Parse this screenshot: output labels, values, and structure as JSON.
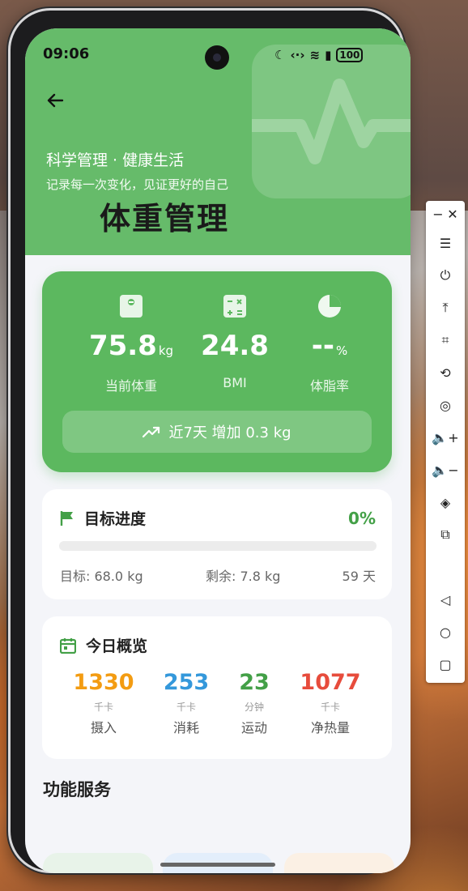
{
  "status_bar": {
    "time": "09:06",
    "battery": "100"
  },
  "header": {
    "subtitle": "科学管理 · 健康生活",
    "slogan": "记录每一次变化，见证更好的自己",
    "title": "体重管理"
  },
  "stats": {
    "weight": {
      "value": "75.8",
      "unit": "kg",
      "label": "当前体重"
    },
    "bmi": {
      "value": "24.8",
      "label": "BMI"
    },
    "body_fat": {
      "value": "--",
      "unit": "%",
      "label": "体脂率"
    },
    "trend": "近7天 增加 0.3 kg"
  },
  "goal": {
    "title": "目标进度",
    "percent": "0%",
    "progress_fraction": 0,
    "target": "目标: 68.0 kg",
    "remaining": "剩余: 7.8 kg",
    "days": "59 天"
  },
  "today": {
    "title": "今日概览",
    "items": [
      {
        "value": "1330",
        "unit": "千卡",
        "label": "摄入",
        "color": "#f39c12"
      },
      {
        "value": "253",
        "unit": "千卡",
        "label": "消耗",
        "color": "#3498db"
      },
      {
        "value": "23",
        "unit": "分钟",
        "label": "运动",
        "color": "#43a047"
      },
      {
        "value": "1077",
        "unit": "千卡",
        "label": "净热量",
        "color": "#e74c3c"
      }
    ]
  },
  "services": {
    "title": "功能服务"
  },
  "colors": {
    "primary": "#66bb6a",
    "card_green": "#5cb85f"
  }
}
